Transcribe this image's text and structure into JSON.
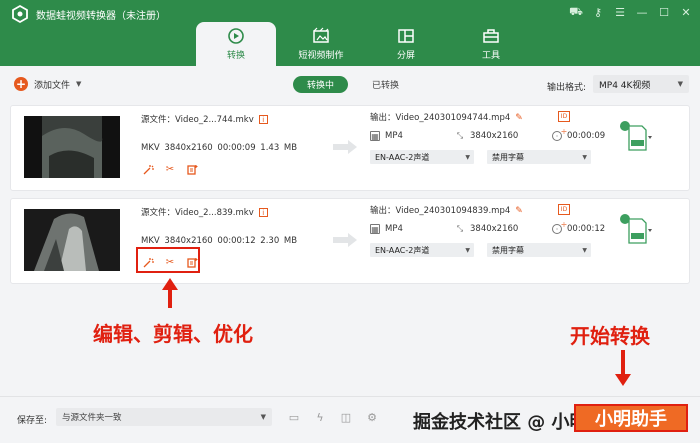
{
  "app": {
    "title": "数据蛙视频转换器（未注册）"
  },
  "tabs": [
    {
      "label": "转换"
    },
    {
      "label": "短视频制作"
    },
    {
      "label": "分屏"
    },
    {
      "label": "工具"
    }
  ],
  "toolbar": {
    "add_file": "添加文件",
    "seg_converting": "转换中",
    "seg_converted": "已转换",
    "output_format_label": "输出格式:",
    "output_format_value": "MP4 4K视频"
  },
  "files": [
    {
      "source_name": "源文件：Video_2...744.mkv",
      "source_meta": "MKV  3840x2160  00:00:09  1.43 MB",
      "output_name": "输出：Video_240301094744.mp4",
      "output_format": "MP4",
      "output_resolution": "3840x2160",
      "output_duration": "00:00:09",
      "audio_track": "EN-AAC-2声道",
      "subtitle": "禁用字幕"
    },
    {
      "source_name": "源文件：Video_2...839.mkv",
      "source_meta": "MKV  3840x2160  00:00:12  2.30 MB",
      "output_name": "输出：Video_240301094839.mp4",
      "output_format": "MP4",
      "output_resolution": "3840x2160",
      "output_duration": "00:00:12",
      "audio_track": "EN-AAC-2声道",
      "subtitle": "禁用字幕"
    }
  ],
  "annotations": {
    "edit_tools": "编辑、剪辑、优化",
    "start": "开始转换"
  },
  "footer": {
    "save_label": "保存至:",
    "save_path": "与源文件夹一致",
    "watermark": "掘金技术社区 @ 小明助手",
    "start_button": "小明助手"
  },
  "colors": {
    "brand_green": "#2e8b4a",
    "accent_orange": "#e6591e",
    "annotation_red": "#e02010"
  }
}
